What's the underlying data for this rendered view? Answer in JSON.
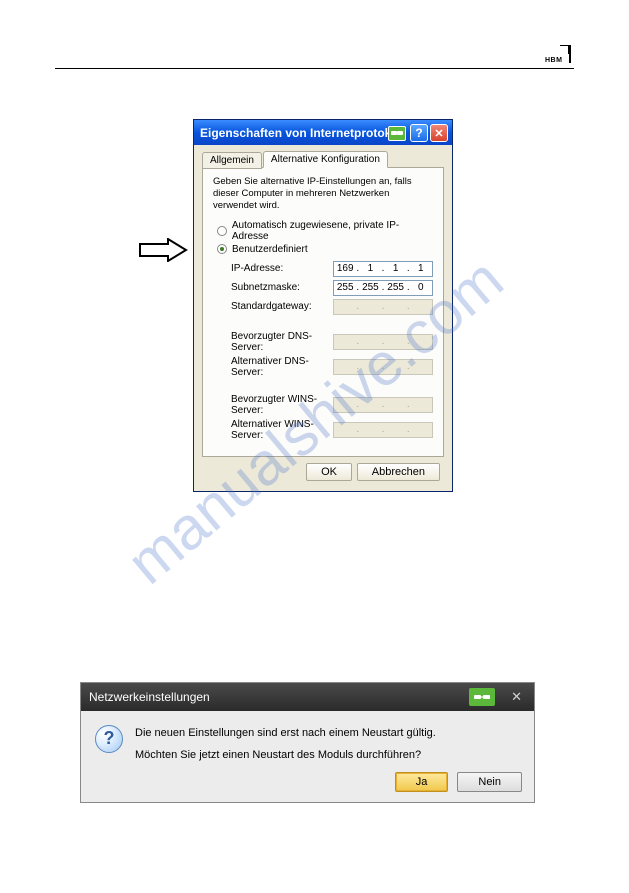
{
  "logo_text": "HBM",
  "watermark": "manualshive.com",
  "xp": {
    "title": "Eigenschaften von Internetprotok",
    "tab_general": "Allgemein",
    "tab_alt": "Alternative Konfiguration",
    "intro": "Geben Sie alternative IP-Einstellungen an, falls dieser Computer in mehreren Netzwerken verwendet wird.",
    "radio_auto": "Automatisch zugewiesene, private IP-Adresse",
    "radio_user": "Benutzerdefiniert",
    "fields": {
      "ip_label": "IP-Adresse:",
      "ip": [
        "169",
        "1",
        "1",
        "1"
      ],
      "subnet_label": "Subnetzmaske:",
      "subnet": [
        "255",
        "255",
        "255",
        "0"
      ],
      "gateway_label": "Standardgateway:",
      "dns1_label": "Bevorzugter DNS-Server:",
      "dns2_label": "Alternativer DNS-Server:",
      "wins1_label": "Bevorzugter WINS-Server:",
      "wins2_label": "Alternativer WINS-Server:"
    },
    "ok": "OK",
    "cancel": "Abbrechen"
  },
  "dark": {
    "title": "Netzwerkeinstellungen",
    "line1": "Die neuen Einstellungen sind erst nach einem Neustart gültig.",
    "line2": "Möchten Sie jetzt einen Neustart des Moduls durchführen?",
    "yes": "Ja",
    "no": "Nein"
  }
}
